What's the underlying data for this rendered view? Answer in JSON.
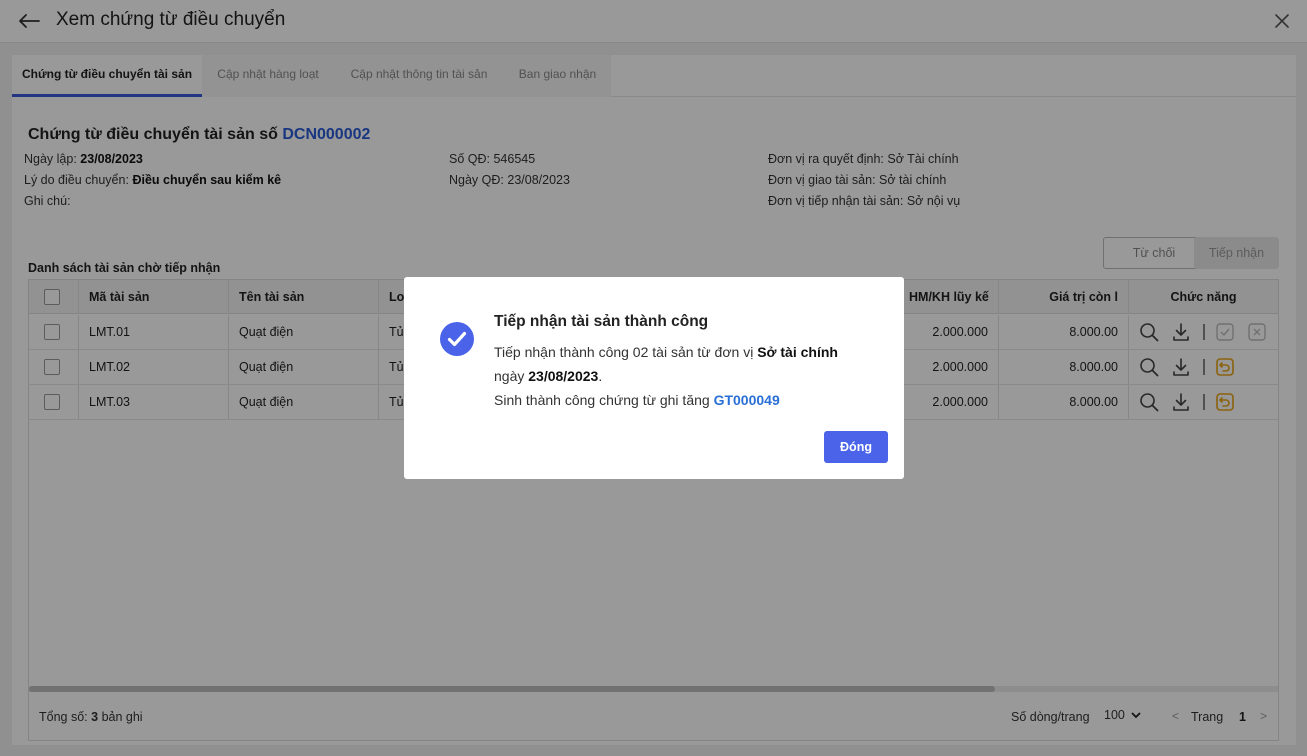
{
  "header": {
    "title": "Xem chứng từ điều chuyển"
  },
  "tabs": [
    {
      "label": "Chứng từ điều chuyển tài sản",
      "active": true
    },
    {
      "label": "Cập nhật hàng loạt",
      "active": false
    },
    {
      "label": "Cập nhật thông tin tài sản",
      "active": false
    },
    {
      "label": "Ban giao nhận",
      "active": false
    }
  ],
  "document": {
    "title_prefix": "Chứng từ điều chuyển tài sản số",
    "code": "DCN000002",
    "info": {
      "ngay_lap_label": "Ngày lập:",
      "ngay_lap": "23/08/2023",
      "ly_do_label": "Lý do điều chuyển:",
      "ly_do": "Điều chuyển sau kiểm kê",
      "ghi_chu_label": "Ghi chú:",
      "so_qd_label": "Số QĐ:",
      "so_qd": "546545",
      "ngay_qd_label": "Ngày QĐ:",
      "ngay_qd": "23/08/2023",
      "don_vi_qd_label": "Đơn vị ra quyết định:",
      "don_vi_qd": "Sở Tài chính",
      "don_vi_giao_label": "Đơn vị giao tài sản:",
      "don_vi_giao": "Sở tài chính",
      "don_vi_nhan_label": "Đơn vị tiếp nhận tài sản:",
      "don_vi_nhan": "Sở nội vụ"
    }
  },
  "list": {
    "title": "Danh sách tài sản chờ tiếp nhận",
    "reject_label": "Từ chối",
    "receive_label": "Tiếp nhận",
    "columns": {
      "ma": "Mã tài sản",
      "ten": "Tên tài sản",
      "loai": "Lo",
      "hmkh": "HM/KH lũy kế",
      "gtcl": "Giá trị còn l",
      "chuc_nang": "Chức năng"
    },
    "rows": [
      {
        "ma": "LMT.01",
        "ten": "Quạt điện",
        "loai": "Tủ",
        "hmkh": "2.000.000",
        "gtcl": "8.000.00"
      },
      {
        "ma": "LMT.02",
        "ten": "Quạt điện",
        "loai": "Tủ",
        "hmkh": "2.000.000",
        "gtcl": "8.000.00"
      },
      {
        "ma": "LMT.03",
        "ten": "Quạt điện",
        "loai": "Tủ",
        "hmkh": "2.000.000",
        "gtcl": "8.000.00"
      }
    ],
    "footer": {
      "total_prefix": "Tổng số:",
      "total_count": "3",
      "total_suffix": "bản ghi",
      "rows_per_page_label": "Số dòng/trang",
      "rows_per_page": "100",
      "page_label": "Trang",
      "page": "1"
    }
  },
  "modal": {
    "title": "Tiếp nhận tài sản thành công",
    "line1_prefix": "Tiếp nhận thành công 02 tài sản từ đơn vị",
    "line1_unit": "Sở tài chính",
    "line2_prefix": "ngày",
    "line2_date": "23/08/2023",
    "line2_suffix": ".",
    "line3_prefix": "Sinh thành công chứng từ ghi tăng",
    "line3_code": "GT000049",
    "close_label": "Đóng"
  },
  "colors": {
    "accent": "#4a63e8",
    "link": "#2a6fd6",
    "warning": "#e8a317"
  }
}
